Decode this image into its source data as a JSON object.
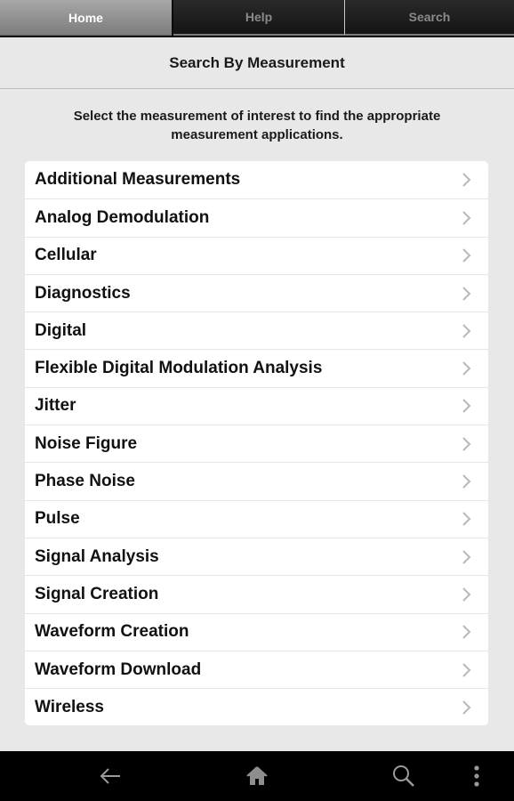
{
  "tabs": [
    {
      "label": "Home",
      "active": true
    },
    {
      "label": "Help",
      "active": false
    },
    {
      "label": "Search",
      "active": false
    }
  ],
  "header": {
    "title": "Search By Measurement"
  },
  "subtitle": "Select the measurement of interest to find the appropriate measurement applications.",
  "measurements": [
    {
      "label": "Additional Measurements",
      "icon": "chevron-right-icon"
    },
    {
      "label": "Analog Demodulation",
      "icon": "chevron-right-icon"
    },
    {
      "label": "Cellular",
      "icon": "chevron-right-icon"
    },
    {
      "label": "Diagnostics",
      "icon": "chevron-right-icon"
    },
    {
      "label": "Digital",
      "icon": "chevron-right-icon"
    },
    {
      "label": "Flexible Digital Modulation Analysis",
      "icon": "chevron-right-icon"
    },
    {
      "label": "Jitter",
      "icon": "chevron-right-icon"
    },
    {
      "label": "Noise Figure",
      "icon": "chevron-right-icon"
    },
    {
      "label": "Phase Noise",
      "icon": "chevron-right-icon"
    },
    {
      "label": "Pulse",
      "icon": "chevron-right-icon"
    },
    {
      "label": "Signal Analysis",
      "icon": "chevron-right-icon"
    },
    {
      "label": "Signal Creation",
      "icon": "chevron-right-icon"
    },
    {
      "label": "Waveform Creation",
      "icon": "chevron-right-icon"
    },
    {
      "label": "Waveform Download",
      "icon": "chevron-right-icon"
    },
    {
      "label": "Wireless",
      "icon": "chevron-right-icon"
    }
  ],
  "navbar": {
    "icons": [
      "back-arrow-icon",
      "home-icon",
      "search-icon",
      "overflow-menu-icon"
    ]
  },
  "colors": {
    "active_tab": "#8e8e8e",
    "inactive_tab_text": "#8a8a8a",
    "background": "#e8e8e8",
    "chevron": "#b8b8b8"
  }
}
